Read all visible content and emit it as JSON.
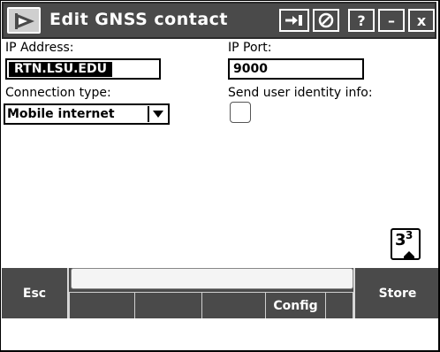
{
  "window": {
    "title": "Edit GNSS contact",
    "icons": {
      "app": "trimble-app-icon",
      "switch": "switch-app-icon",
      "keyboard": "keyboard-icon",
      "help": "?",
      "minimize": "–",
      "close": "x"
    }
  },
  "form": {
    "ip_address_label": "IP Address:",
    "ip_address_value": "RTN.LSU.EDU",
    "ip_port_label": "IP Port:",
    "ip_port_value": "9000",
    "connection_type_label": "Connection type:",
    "connection_type_value": "Mobile internet",
    "send_identity_label": "Send user identity info:",
    "send_identity_checked": false
  },
  "page_indicator": {
    "current": "3",
    "total": "3"
  },
  "softkeys": {
    "esc": "Esc",
    "config": "Config",
    "store": "Store"
  }
}
